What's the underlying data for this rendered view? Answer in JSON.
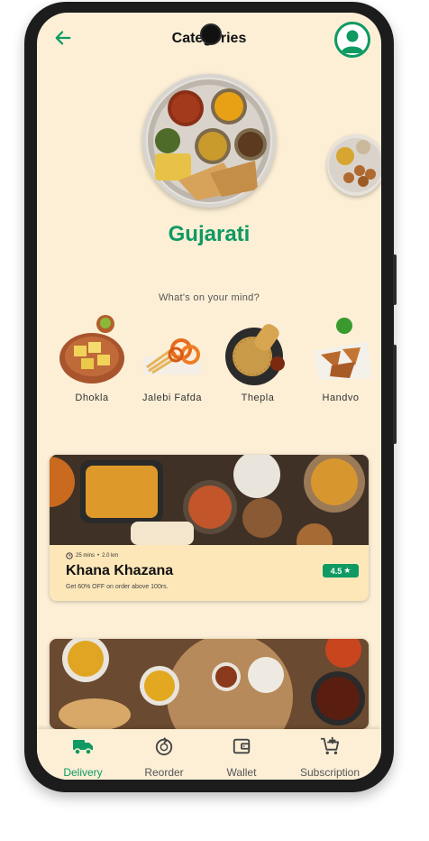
{
  "header": {
    "title": "Categories"
  },
  "category": {
    "name": "Gujarati"
  },
  "section": {
    "prompt": "What's on your mind?"
  },
  "dishes": [
    {
      "label": "Dhokla"
    },
    {
      "label": "Jalebi Fafda"
    },
    {
      "label": "Thepla"
    },
    {
      "label": "Handvo"
    }
  ],
  "restaurant": {
    "time": "25 mins",
    "distance": "2.0 km",
    "name": "Khana Khazana",
    "offer": "Get 60% OFF on order above 100rs.",
    "rating": "4.5"
  },
  "nav": [
    {
      "label": "Delivery"
    },
    {
      "label": "Reorder"
    },
    {
      "label": "Wallet"
    },
    {
      "label": "Subscription"
    }
  ],
  "colors": {
    "accent": "#0e9a62",
    "background": "#fcefd6",
    "card": "#fde7b9"
  }
}
